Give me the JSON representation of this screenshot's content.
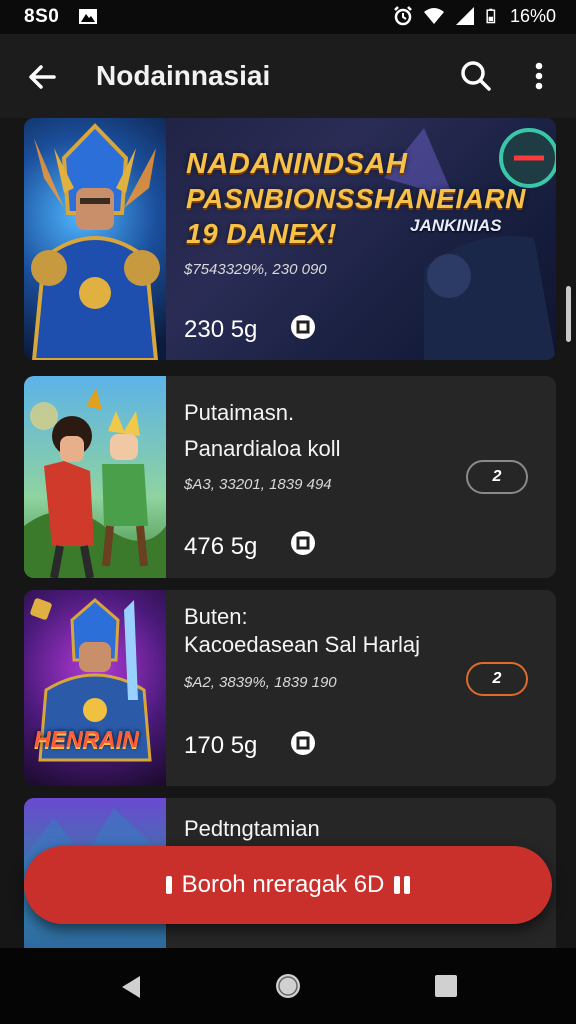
{
  "status_bar": {
    "time": "8S0",
    "battery_text": "16%0"
  },
  "app_bar": {
    "title": "Nodainnasiai"
  },
  "featured": {
    "line1": "NADANINDSAH",
    "line2": "PASNBIONSSHANEIARN",
    "line3": "19 DANEX!",
    "tag": "JANKINIAS",
    "meta": "$7543329%, 230 090",
    "price": "230 5g"
  },
  "cards": [
    {
      "title1": "Putaimasn.",
      "title2": "Panardialoa koll",
      "meta": "$A3, 33201, 1839 494",
      "price": "476 5g",
      "action_label": "2",
      "action_style": "gray"
    },
    {
      "title1": "Buten:",
      "title2": "Kacoedasean Sal Harlaj",
      "meta": "$A2, 3839%, 1839 190",
      "price": "170 5g",
      "action_label": "2",
      "action_style": "orange",
      "thumb_caption": "HENRAIN"
    },
    {
      "title1": "Pedtngtamian"
    }
  ],
  "cta": {
    "label": "Boroh nreragak 6D"
  },
  "colors": {
    "accent_red": "#c9302c",
    "orange": "#e06a2a",
    "gold": "#f7c24a"
  }
}
